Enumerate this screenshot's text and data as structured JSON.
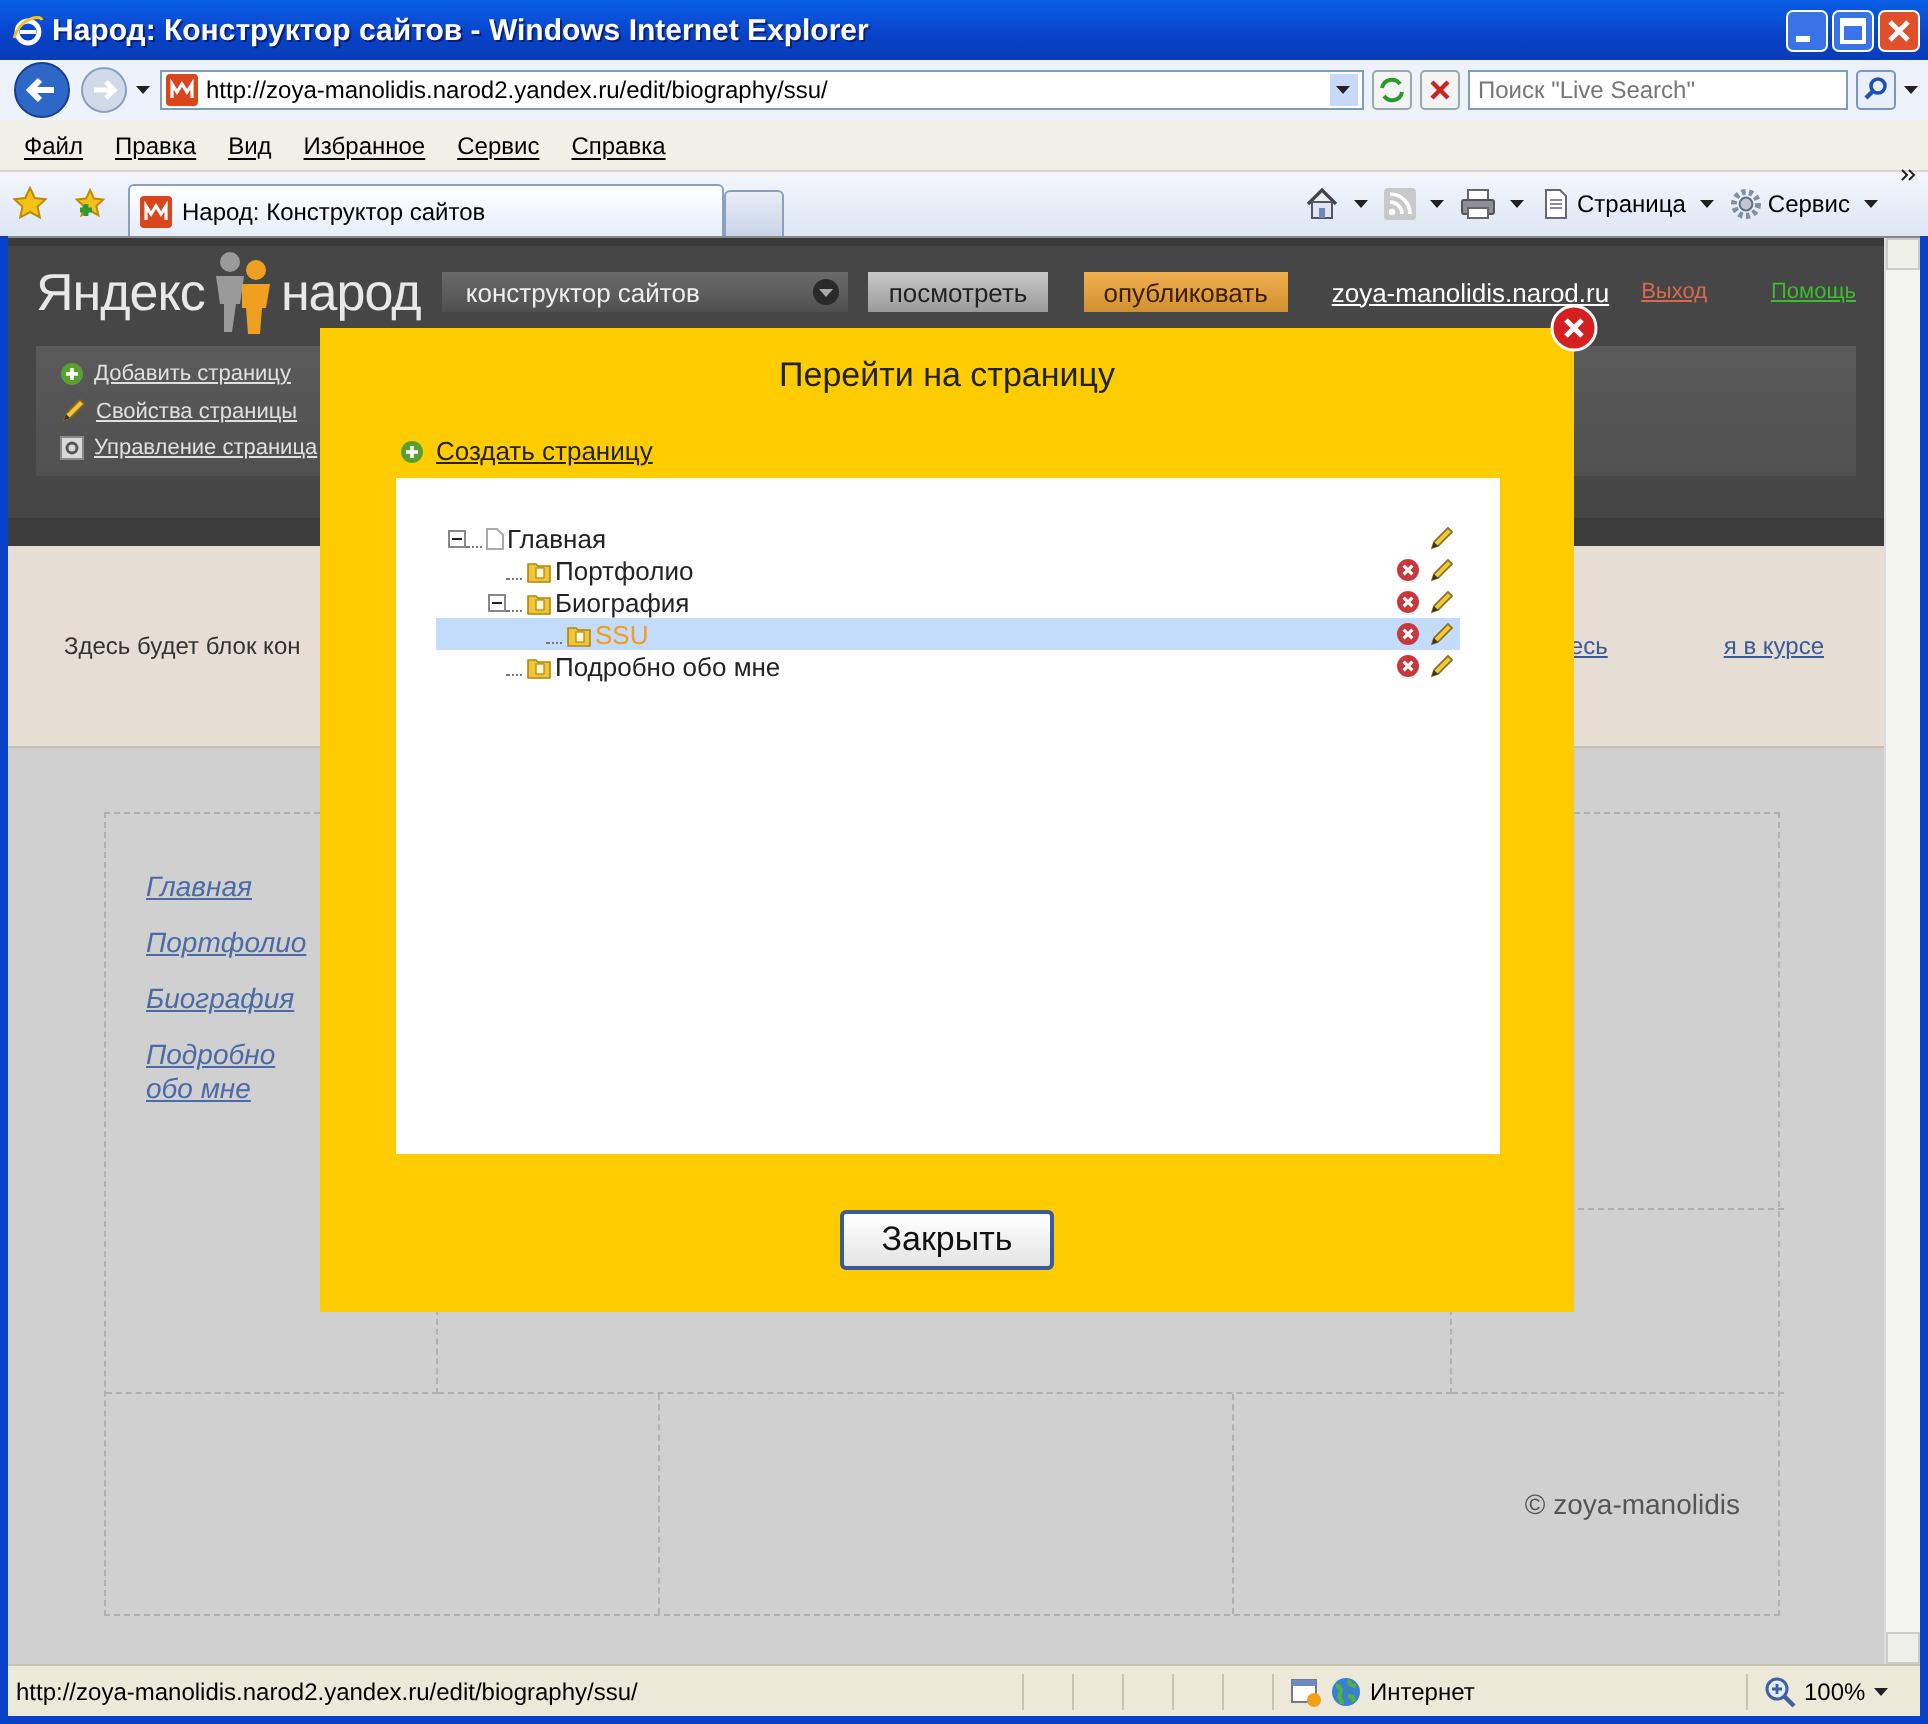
{
  "window": {
    "title": "Народ: Конструктор сайтов - Windows Internet Explorer"
  },
  "address_bar": {
    "url": "http://zoya-manolidis.narod2.yandex.ru/edit/biography/ssu/"
  },
  "search": {
    "placeholder": "Поиск \"Live Search\""
  },
  "menu": [
    "Файл",
    "Правка",
    "Вид",
    "Избранное",
    "Сервис",
    "Справка"
  ],
  "tabs": [
    {
      "label": "Народ: Конструктор сайтов",
      "selected": true
    }
  ],
  "command_bar": [
    "Страница",
    "Сервис"
  ],
  "site_header": {
    "logo_left": "Яндекс",
    "logo_right": "народ",
    "mode_select": "конструктор сайтов",
    "buttons": [
      "посмотреть",
      "опубликовать"
    ],
    "user": "zoya-manolidis.narod.ru",
    "links": [
      "Выход",
      "Помощь"
    ]
  },
  "page_tools": [
    "Добавить страницу",
    "Свойства страницы",
    "Управление страница"
  ],
  "notice": {
    "text": "Здесь будет блок кон",
    "link": "есь",
    "dismiss": "я в курсе"
  },
  "site_nav": [
    "Главная",
    "Портфолио",
    "Биография",
    "Подробно обо мне"
  ],
  "footer": "© zoya-manolidis",
  "dialog": {
    "title": "Перейти на страницу",
    "create_link": "Создать страницу",
    "close_button": "Закрыть",
    "tree": [
      {
        "label": "Главная",
        "kind": "home",
        "selected": false,
        "expanded": true,
        "deletable": false,
        "children": [
          {
            "label": "Портфолио",
            "kind": "folder",
            "selected": false,
            "deletable": true
          },
          {
            "label": "Биография",
            "kind": "folder",
            "selected": false,
            "expanded": true,
            "deletable": true,
            "children": [
              {
                "label": "SSU",
                "kind": "folder",
                "selected": true,
                "deletable": true
              }
            ]
          },
          {
            "label": "Подробно обо мне",
            "kind": "folder",
            "selected": false,
            "deletable": true
          }
        ]
      }
    ]
  },
  "status_bar": {
    "url": "http://zoya-manolidis.narod2.yandex.ru/edit/biography/ssu/",
    "zone": "Интернет",
    "zoom": "100%"
  }
}
